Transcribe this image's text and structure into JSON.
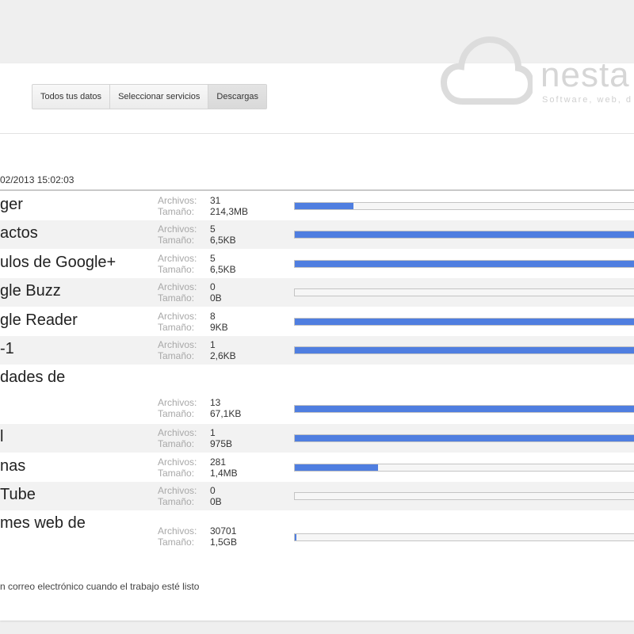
{
  "tabs": [
    "Todos tus datos",
    "Seleccionar servicios",
    "Descargas"
  ],
  "active_tab": 2,
  "logo": {
    "text": "nesta",
    "subtitle": "Software, web, d"
  },
  "datestamp": "02/2013 15:02:03",
  "labels": {
    "files": "Archivos:",
    "size": "Tamaño:"
  },
  "services": [
    {
      "name": "ger",
      "files": "31",
      "size": "214,3MB",
      "progress": 0.17
    },
    {
      "name": "actos",
      "files": "5",
      "size": "6,5KB",
      "progress": 1
    },
    {
      "name": "ulos de Google+",
      "files": "5",
      "size": "6,5KB",
      "progress": 1
    },
    {
      "name": "gle Buzz",
      "files": "0",
      "size": "0B",
      "progress": 0
    },
    {
      "name": "gle Reader",
      "files": "8",
      "size": "9KB",
      "progress": 1
    },
    {
      "name": "-1",
      "files": "1",
      "size": "2,6KB",
      "progress": 1
    },
    {
      "name": "dades de",
      "files": "13",
      "size": "67,1KB",
      "progress": 1
    },
    {
      "name": "l",
      "files": "1",
      "size": "975B",
      "progress": 1
    },
    {
      "name": "nas",
      "files": "281",
      "size": "1,4MB",
      "progress": 0.24
    },
    {
      "name": "Tube",
      "files": "0",
      "size": "0B",
      "progress": 0
    },
    {
      "name": "mes web de",
      "files": "30701",
      "size": "1,5GB",
      "progress": 0.005
    }
  ],
  "notify_text": "n correo electrónico cuando el trabajo esté listo",
  "colors": {
    "bar_fill": "#4f7ee0",
    "row_alt": "#f2f2f2"
  }
}
